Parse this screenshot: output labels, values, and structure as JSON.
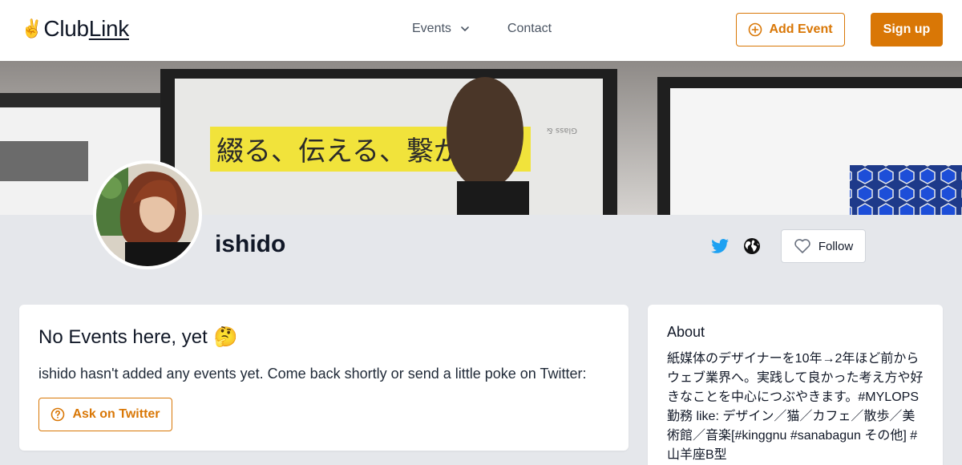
{
  "header": {
    "logo_text_1": "Club",
    "logo_text_2": "Link",
    "nav": {
      "events_label": "Events",
      "contact_label": "Contact"
    },
    "add_event_label": "Add Event",
    "sign_up_label": "Sign up"
  },
  "banner": {
    "caption": "綴る、伝える、繋がる。",
    "glass_text": "Glass &"
  },
  "profile": {
    "name": "ishido",
    "follow_label": "Follow"
  },
  "events": {
    "title": "No Events here, yet",
    "emoji": "🤔",
    "text": "ishido hasn't added any events yet. Come back shortly or send a little poke on Twitter:",
    "ask_label": "Ask on Twitter"
  },
  "about": {
    "title": "About",
    "text": "紙媒体のデザイナーを10年→2年ほど前からウェブ業界へ。実践して良かった考え方や好きなことを中心につぶやきます。#MYLOPS勤務 like: デザイン／猫／カフェ／散歩／美術館／音楽[#kinggnu #sanabagun その他] #山羊座B型"
  },
  "colors": {
    "accent": "#d97706",
    "twitter": "#1da1f2",
    "page_bg": "#e5e7eb"
  }
}
